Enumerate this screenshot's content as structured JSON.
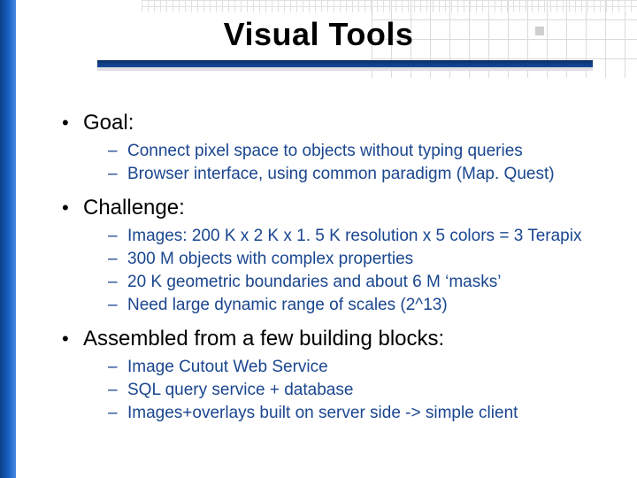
{
  "title": "Visual Tools",
  "sections": [
    {
      "heading": "Goal:",
      "items": [
        "Connect pixel space to objects without typing queries",
        "Browser interface, using common paradigm (Map. Quest)"
      ]
    },
    {
      "heading": "Challenge:",
      "items": [
        "Images: 200 K x 2 K x 1. 5 K resolution x 5 colors = 3 Terapix",
        "300 M objects with complex properties",
        "20 K geometric boundaries and about 6 M ‘masks’",
        "Need large dynamic range of scales (2^13)"
      ]
    },
    {
      "heading": "Assembled from a few building blocks:",
      "items": [
        "Image Cutout Web Service",
        "SQL query service + database",
        "Images+overlays built on server side -> simple client"
      ]
    }
  ]
}
